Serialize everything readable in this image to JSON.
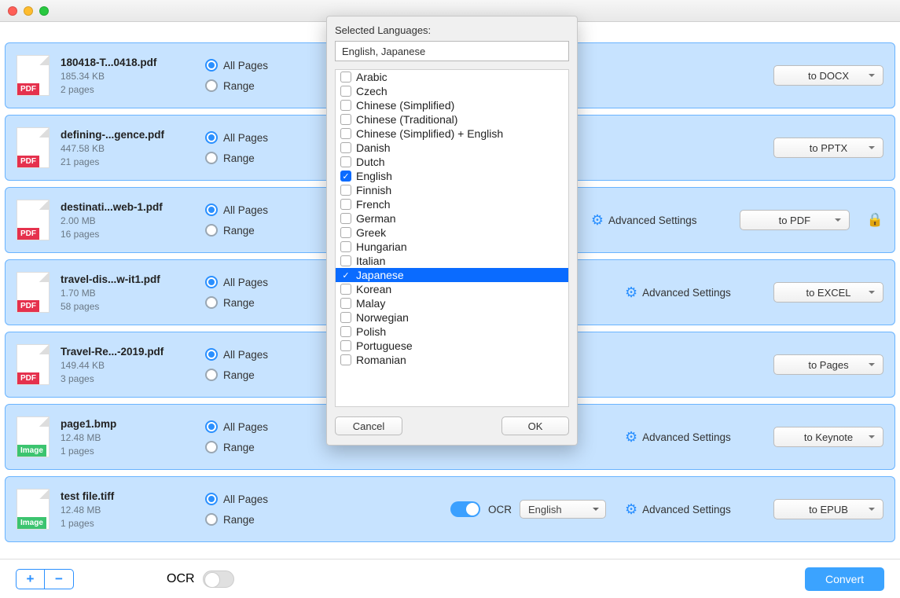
{
  "toolbar": {
    "segmented_active": 0
  },
  "files": [
    {
      "name": "180418-T...0418.pdf",
      "size": "185.34 KB",
      "pages": "2 pages",
      "type": "PDF",
      "allPages": "All Pages",
      "range": "Range",
      "ocr": "",
      "advanced": "",
      "format": "to DOCX",
      "locked": false
    },
    {
      "name": "defining-...gence.pdf",
      "size": "447.58 KB",
      "pages": "21 pages",
      "type": "PDF",
      "allPages": "All Pages",
      "range": "Range",
      "ocr": "",
      "advanced": "",
      "format": "to PPTX",
      "locked": false
    },
    {
      "name": "destinati...web-1.pdf",
      "size": "2.00 MB",
      "pages": "16 pages",
      "type": "PDF",
      "allPages": "All Pages",
      "range": "Range",
      "ocr": "",
      "advanced": "Advanced Settings",
      "format": "to PDF",
      "locked": true
    },
    {
      "name": "travel-dis...w-it1.pdf",
      "size": "1.70 MB",
      "pages": "58 pages",
      "type": "PDF",
      "allPages": "All Pages",
      "range": "Range",
      "ocr": "",
      "advanced": "Advanced Settings",
      "format": "to EXCEL",
      "locked": false
    },
    {
      "name": "Travel-Re...-2019.pdf",
      "size": "149.44 KB",
      "pages": "3 pages",
      "type": "PDF",
      "allPages": "All Pages",
      "range": "Range",
      "ocr": "",
      "advanced": "",
      "format": "to Pages",
      "locked": false
    },
    {
      "name": "page1.bmp",
      "size": "12.48 MB",
      "pages": "1 pages",
      "type": "Image",
      "allPages": "All Pages",
      "range": "Range",
      "ocr": "",
      "advanced": "Advanced Settings",
      "format": "to Keynote",
      "locked": false
    },
    {
      "name": "test file.tiff",
      "size": "12.48 MB",
      "pages": "1 pages",
      "type": "Image",
      "allPages": "All Pages",
      "range": "Range",
      "ocr": "OCR",
      "ocrLang": "English",
      "advanced": "Advanced Settings",
      "format": "to EPUB",
      "locked": false
    }
  ],
  "bottom": {
    "ocr_label": "OCR",
    "convert": "Convert",
    "plus": "+",
    "minus": "−"
  },
  "popup": {
    "title": "Selected Languages:",
    "selected_text": "English, Japanese",
    "cancel": "Cancel",
    "ok": "OK",
    "languages": [
      {
        "label": "Arabic",
        "checked": false,
        "sel": false
      },
      {
        "label": "Czech",
        "checked": false,
        "sel": false
      },
      {
        "label": "Chinese (Simplified)",
        "checked": false,
        "sel": false
      },
      {
        "label": "Chinese (Traditional)",
        "checked": false,
        "sel": false
      },
      {
        "label": "Chinese (Simplified) + English",
        "checked": false,
        "sel": false
      },
      {
        "label": "Danish",
        "checked": false,
        "sel": false
      },
      {
        "label": "Dutch",
        "checked": false,
        "sel": false
      },
      {
        "label": "English",
        "checked": true,
        "sel": false
      },
      {
        "label": "Finnish",
        "checked": false,
        "sel": false
      },
      {
        "label": "French",
        "checked": false,
        "sel": false
      },
      {
        "label": "German",
        "checked": false,
        "sel": false
      },
      {
        "label": "Greek",
        "checked": false,
        "sel": false
      },
      {
        "label": "Hungarian",
        "checked": false,
        "sel": false
      },
      {
        "label": "Italian",
        "checked": false,
        "sel": false
      },
      {
        "label": "Japanese",
        "checked": true,
        "sel": true
      },
      {
        "label": "Korean",
        "checked": false,
        "sel": false
      },
      {
        "label": "Malay",
        "checked": false,
        "sel": false
      },
      {
        "label": "Norwegian",
        "checked": false,
        "sel": false
      },
      {
        "label": "Polish",
        "checked": false,
        "sel": false
      },
      {
        "label": "Portuguese",
        "checked": false,
        "sel": false
      },
      {
        "label": "Romanian",
        "checked": false,
        "sel": false
      }
    ]
  }
}
